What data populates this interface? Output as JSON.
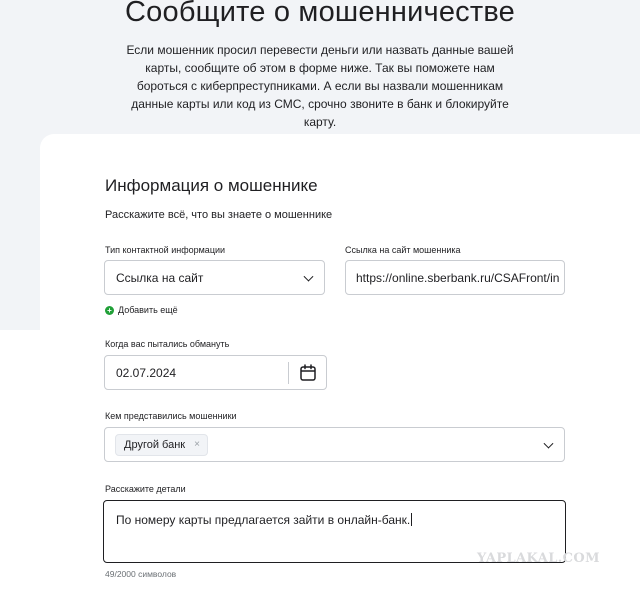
{
  "page": {
    "title": "Сообщите о мошенничестве",
    "intro": "Если мошенник просил перевести деньги или назвать данные вашей карты, сообщите об этом в форме ниже. Так вы поможете нам бороться с киберпреступниками. А если вы назвали мошенникам данные карты или код из СМС, срочно звоните в банк и блокируйте карту."
  },
  "form": {
    "section_title": "Информация о мошеннике",
    "section_subtitle": "Расскажите всё, что вы знаете о мошеннике",
    "contact_type": {
      "label": "Тип контактной информации",
      "value": "Ссылка на сайт"
    },
    "site_link": {
      "label": "Ссылка на сайт мошенника",
      "value": "https://online.sberbank.ru/CSAFront/in"
    },
    "add_more": "Добавить ещё",
    "date": {
      "label": "Когда вас пытались обмануть",
      "value": "02.07.2024"
    },
    "impersonated": {
      "label": "Кем представились мошенники",
      "chip": "Другой банк",
      "chip_remove": "×"
    },
    "details": {
      "label": "Расскажите детали",
      "value": "По номеру карты предлагается зайти в онлайн-банк.",
      "counter": "49/2000 символов"
    }
  },
  "watermark": "YAPLAKAL.COM",
  "colors": {
    "accent": "#21a038",
    "band": "#f2f4f7",
    "border": "#c9ccd1"
  },
  "icons": [
    "chevron-down-icon",
    "calendar-icon",
    "plus-circle-icon",
    "close-icon"
  ]
}
